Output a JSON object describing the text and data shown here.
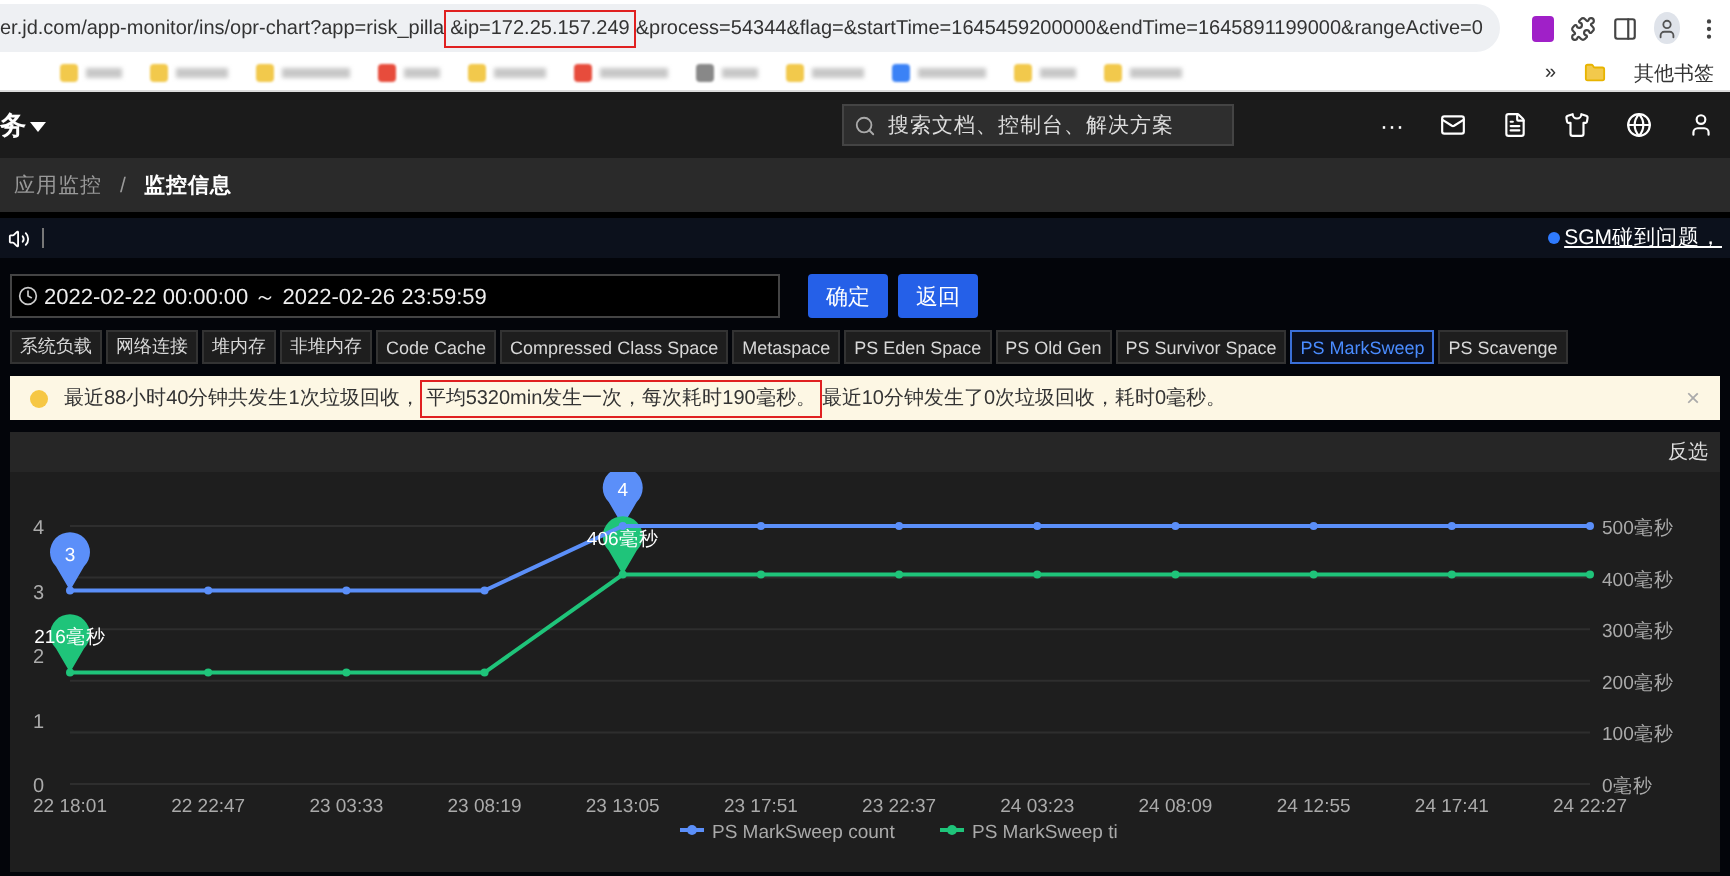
{
  "browser": {
    "address_parts": [
      {
        "text": "er.jd.com/app-monitor/ins/opr-chart?app=risk_pilla",
        "boxed": false
      },
      {
        "text": "&ip=172.25.157.249",
        "boxed": true
      },
      {
        "text": "&process=54344&flag=&startTime=1645459200000&endTime=1645891199000&rangeActive=0",
        "boxed": false
      }
    ],
    "bookmarks_more": "»",
    "other_bookmarks": "其他书签"
  },
  "header": {
    "menu_label": "务",
    "search": {
      "placeholder": "搜索文档、控制台、解决方案"
    },
    "more": "···"
  },
  "breadcrumb": [
    {
      "label": "应用监控",
      "current": false
    },
    {
      "label": "监控信息",
      "current": true
    }
  ],
  "breadcrumb_separator": "/",
  "notice": {
    "link": "SGM碰到问题，"
  },
  "date_range": {
    "value": "2022-02-22 00:00:00 ～ 2022-02-26 23:59:59"
  },
  "buttons": [
    "确定",
    "返回"
  ],
  "tabs": [
    {
      "label": "系统负载",
      "selected": false
    },
    {
      "label": "网络连接",
      "selected": false
    },
    {
      "label": "堆内存",
      "selected": false
    },
    {
      "label": "非堆内存",
      "selected": false
    },
    {
      "label": "Code Cache",
      "selected": false
    },
    {
      "label": "Compressed Class Space",
      "selected": false
    },
    {
      "label": "Metaspace",
      "selected": false
    },
    {
      "label": "PS Eden Space",
      "selected": false
    },
    {
      "label": "PS Old Gen",
      "selected": false
    },
    {
      "label": "PS Survivor Space",
      "selected": false
    },
    {
      "label": "PS MarkSweep",
      "selected": true
    },
    {
      "label": "PS Scavenge",
      "selected": false
    }
  ],
  "alert": {
    "parts": [
      {
        "text": "最近88小时40分钟共发生1次垃圾回收，",
        "boxed": false
      },
      {
        "text": "平均5320min发生一次，每次耗时190毫秒。",
        "boxed": true
      },
      {
        "text": "最近10分钟发生了0次垃圾回收，耗时0毫秒。",
        "boxed": false
      }
    ],
    "close": "×"
  },
  "chart_panel": {
    "invert_label": "反选",
    "chart_data": {
      "type": "line",
      "categories": [
        "22 18:01",
        "22 22:47",
        "23 03:33",
        "23 08:19",
        "23 13:05",
        "23 17:51",
        "23 22:37",
        "24 03:23",
        "24 08:09",
        "24 12:55",
        "24 17:41",
        "24 22:27"
      ],
      "series": [
        {
          "name": "PS MarkSweep count",
          "color": "#5b8ff9",
          "marker": "circle",
          "values": [
            3,
            3,
            3,
            3,
            4,
            4,
            4,
            4,
            4,
            4,
            4,
            4
          ]
        },
        {
          "name": "PS MarkSweep ti",
          "color": "#1fc47a",
          "marker": "circle",
          "axis": "y2",
          "values": [
            216,
            216,
            216,
            216,
            406,
            406,
            406,
            406,
            406,
            406,
            406,
            406
          ]
        }
      ],
      "grid": true,
      "legend": "bottom",
      "ylim": [
        0,
        4
      ],
      "yticks": [
        0,
        1,
        2,
        3,
        4
      ],
      "y2lim": [
        0,
        500
      ],
      "y2ticks": [
        {
          "value": 0,
          "label": "0毫秒"
        },
        {
          "value": 100,
          "label": "100毫秒"
        },
        {
          "value": 200,
          "label": "200毫秒"
        },
        {
          "value": 300,
          "label": "300毫秒"
        },
        {
          "value": 400,
          "label": "400毫秒"
        },
        {
          "value": 500,
          "label": "500毫秒"
        }
      ],
      "annotations": [
        {
          "x": "22 18:01",
          "y": 3,
          "text": "3"
        },
        {
          "x": "23 13:05",
          "y": 4,
          "text": "4"
        },
        "216毫秒",
        "406毫秒"
      ]
    }
  }
}
